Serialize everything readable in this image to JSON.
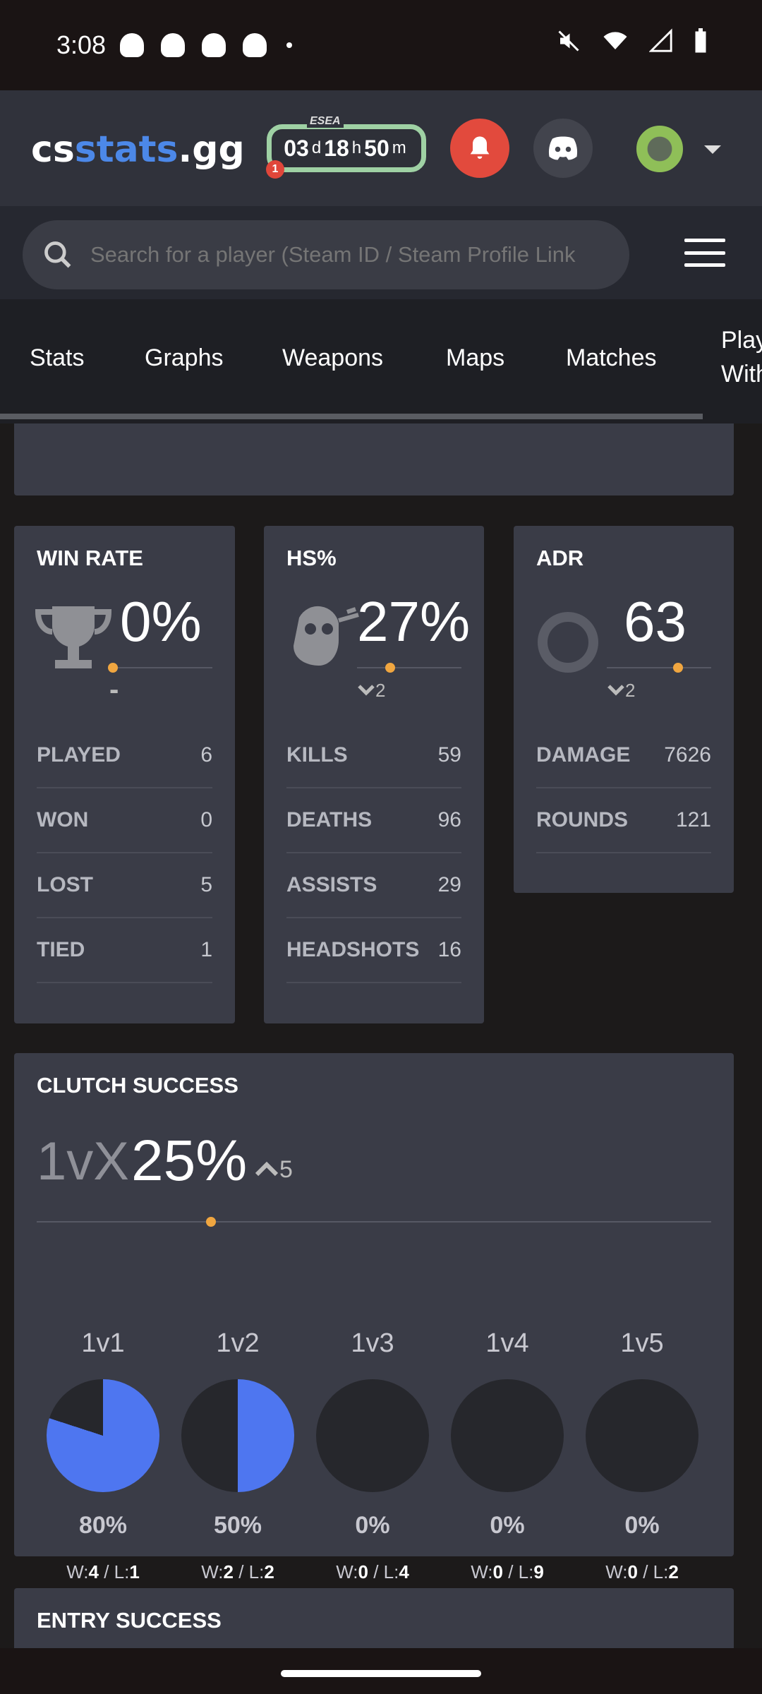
{
  "status": {
    "time": "3:08"
  },
  "header": {
    "logo_a": "cs",
    "logo_b": "stats",
    "logo_c": ".gg",
    "esea_tag": "ESEA",
    "esea_d": "03",
    "esea_h": "18",
    "esea_m": "50",
    "esea_badge": "1"
  },
  "search": {
    "placeholder": "Search for a player (Steam ID / Steam Profile Link"
  },
  "tabs": [
    "Stats",
    "Graphs",
    "Weapons",
    "Maps",
    "Matches",
    "Play With"
  ],
  "win_rate": {
    "title": "WIN RATE",
    "value": "0%",
    "sub": "-",
    "rows": [
      [
        "PLAYED",
        "6"
      ],
      [
        "WON",
        "0"
      ],
      [
        "LOST",
        "5"
      ],
      [
        "TIED",
        "1"
      ]
    ]
  },
  "hs": {
    "title": "HS%",
    "value": "27%",
    "sub": "2",
    "rows": [
      [
        "KILLS",
        "59"
      ],
      [
        "DEATHS",
        "96"
      ],
      [
        "ASSISTS",
        "29"
      ],
      [
        "HEADSHOTS",
        "16"
      ]
    ]
  },
  "adr": {
    "title": "ADR",
    "value": "63",
    "sub": "2",
    "rows": [
      [
        "DAMAGE",
        "7626"
      ],
      [
        "ROUNDS",
        "121"
      ]
    ]
  },
  "clutch": {
    "title": "CLUTCH SUCCESS",
    "label": "1vX",
    "value": "25%",
    "change": "5",
    "items": [
      {
        "label": "1v1",
        "pct": "80%",
        "w": "4",
        "l": "1",
        "frac": 0.8
      },
      {
        "label": "1v2",
        "pct": "50%",
        "w": "2",
        "l": "2",
        "frac": 0.5
      },
      {
        "label": "1v3",
        "pct": "0%",
        "w": "0",
        "l": "4",
        "frac": 0
      },
      {
        "label": "1v4",
        "pct": "0%",
        "w": "0",
        "l": "9",
        "frac": 0
      },
      {
        "label": "1v5",
        "pct": "0%",
        "w": "0",
        "l": "2",
        "frac": 0
      }
    ]
  },
  "entry": {
    "title": "ENTRY SUCCESS"
  },
  "colors": {
    "accent": "#4c88e8",
    "pie_fill": "#4e76f0",
    "pie_bg": "#26272c",
    "marker": "#f0a640"
  }
}
